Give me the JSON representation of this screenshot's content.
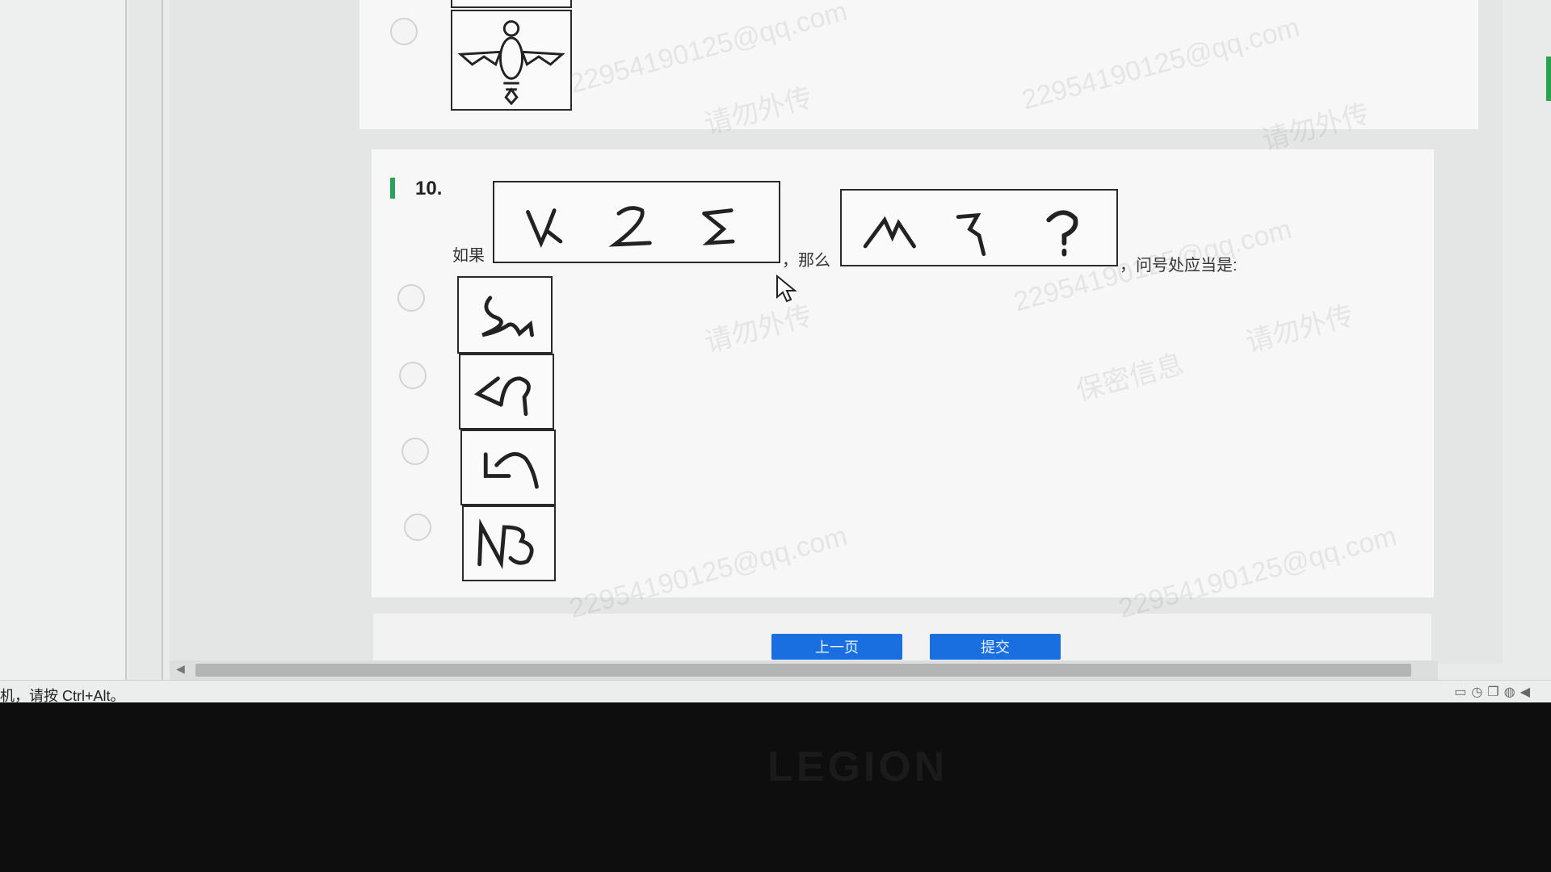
{
  "question": {
    "number": "10.",
    "prefix": "如果",
    "connector": "，那么",
    "suffix": "，问号处应当是:",
    "given_glyphs": [
      "ᒪ",
      "Z",
      "Σ"
    ],
    "target_glyphs": [
      "ʌ",
      "ʅ",
      "?"
    ]
  },
  "options": [
    {
      "icon": "curved-s-glyph-icon"
    },
    {
      "icon": "angle-hook-glyph-icon"
    },
    {
      "icon": "five-like-glyph-icon"
    },
    {
      "icon": "n3-glyph-icon"
    }
  ],
  "buttons": {
    "prev": "上一页",
    "submit": "提交"
  },
  "watermarks": [
    "22954190125@qq.com",
    "请勿外传",
    "保密信息"
  ],
  "status": {
    "text": "机，请按 Ctrl+Alt。"
  },
  "brand": "LEGION",
  "colors": {
    "accent_green": "#2aa35a",
    "button_blue": "#1a6fe0"
  }
}
